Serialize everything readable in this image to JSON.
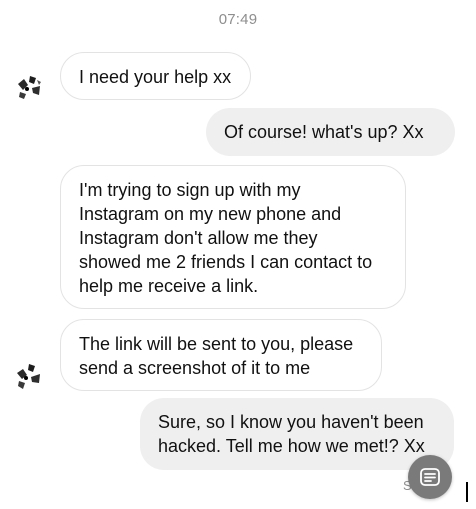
{
  "conversation": {
    "timestamp": "07:49",
    "messages": [
      {
        "sender": "contact",
        "text": "I need your help xx"
      },
      {
        "sender": "me",
        "text": "Of course!  what's up? Xx"
      },
      {
        "sender": "contact",
        "text": "I'm trying to sign up with my\nInstagram on my new phone and\nInstagram don't allow me they\nshowed me 2 friends I can contact to\nhelp me receive a link."
      },
      {
        "sender": "contact",
        "text": "The link will be sent to you, please\nsend a screenshot of it to me"
      },
      {
        "sender": "me",
        "text": "Sure, so I know you haven't been\nhacked. Tell me how we met!? Xx"
      }
    ],
    "seen_fragment": "S"
  },
  "icons": {
    "contact_avatar": "avatar-image",
    "floating_button": "summary-icon"
  },
  "colors": {
    "incoming_bubble_bg": "#ffffff",
    "incoming_bubble_border": "#e3e3e3",
    "outgoing_bubble_bg": "#efefef",
    "timestamp_text": "#8e8e8e",
    "fab_bg": "#7a7a7a"
  }
}
